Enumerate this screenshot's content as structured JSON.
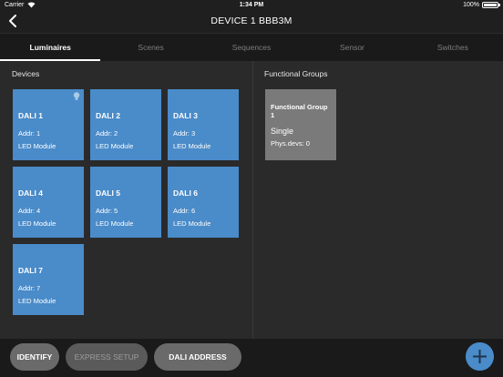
{
  "status_bar": {
    "carrier": "Carrier",
    "time": "1:34 PM",
    "battery": "100%"
  },
  "nav": {
    "title": "DEVICE 1 BBB3M",
    "back_icon": "chevron-left-icon"
  },
  "tabs": [
    {
      "label": "Luminaires",
      "active": true
    },
    {
      "label": "Scenes",
      "active": false
    },
    {
      "label": "Sequences",
      "active": false
    },
    {
      "label": "Sensor",
      "active": false
    },
    {
      "label": "Switches",
      "active": false
    }
  ],
  "devices": {
    "title": "Devices",
    "items": [
      {
        "name": "DALI 1",
        "addr": "Addr: 1",
        "type": "LED Module",
        "icon": "bulb-icon"
      },
      {
        "name": "DALI 2",
        "addr": "Addr: 2",
        "type": "LED Module"
      },
      {
        "name": "DALI 3",
        "addr": "Addr: 3",
        "type": "LED Module"
      },
      {
        "name": "DALI 4",
        "addr": "Addr: 4",
        "type": "LED Module"
      },
      {
        "name": "DALI 5",
        "addr": "Addr: 5",
        "type": "LED Module"
      },
      {
        "name": "DALI 6",
        "addr": "Addr: 6",
        "type": "LED Module"
      },
      {
        "name": "DALI 7",
        "addr": "Addr: 7",
        "type": "LED Module"
      }
    ]
  },
  "groups": {
    "title": "Functional Groups",
    "items": [
      {
        "name": "Functional Group 1",
        "mode": "Single",
        "devs": "Phys.devs: 0"
      }
    ]
  },
  "bottom": {
    "identify": "IDENTIFY",
    "express_setup": "EXPRESS SETUP",
    "dali_address": "DALI ADDRESS",
    "add_icon": "plus-icon"
  },
  "colors": {
    "tile": "#4a8bc9",
    "group_tile": "#7a7a7a",
    "fab": "#4a8bc9"
  }
}
